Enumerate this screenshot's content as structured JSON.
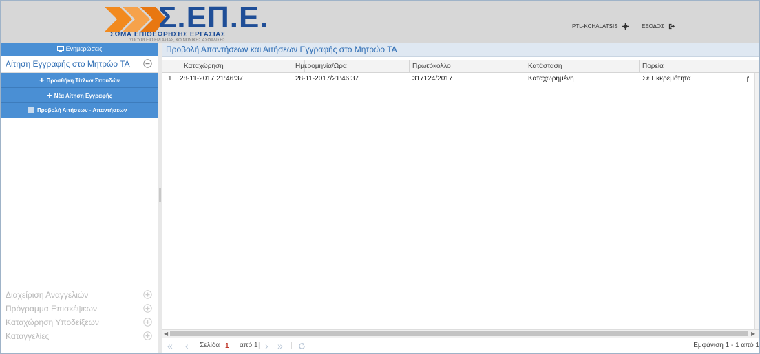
{
  "brand": {
    "logo_mark": "Σ.ΕΠ.Ε.",
    "logo_subtitle": "ΣΩΜΑ ΕΠΙΘΕΩΡΗΣΗΣ ΕΡΓΑΣΙΑΣ",
    "logo_small": "ΥΠΟΥΡΓΕΙΟ ΕΡΓΑΣΙΑΣ, ΚΟΙΝΩΝΙΚΗΣ ΑΣΦΑΛΙΣΗΣ",
    "accent_color": "#1f4e97",
    "chevron_color": "#f28a1e"
  },
  "header": {
    "user": "PTL-KCHALATSIS",
    "user_icon": "gear-icon",
    "logout": "ΕΞΟΔΟΣ",
    "logout_icon": "sign-out-icon"
  },
  "sidebar": {
    "top_item": "Ενημερώσεις",
    "active_section": "Αίτηση Εγγραφής στο Μητρώο ΤΑ",
    "sub_items": [
      {
        "label": "Προσθήκη Τίτλων Σπουδών",
        "icon": "plus-icon"
      },
      {
        "label": "Νέα Αίτηση Εγγραφής",
        "icon": "plus-icon"
      },
      {
        "label": "Προβολή Αιτήσεων - Απαντήσεων",
        "icon": "list-icon"
      }
    ],
    "collapsed_sections": [
      "Διαχείριση Αναγγελιών",
      "Πρόγραμμα Επισκέψεων",
      "Καταχώρηση Υποδείξεων",
      "Καταγγελίες"
    ],
    "color": "#4a8fd4"
  },
  "main": {
    "title": "Προβολή Απαντήσεων και Αιτήσεων Εγγραφής στο Μητρώο ΤΑ",
    "columns": [
      "Καταχώρηση",
      "Ημερομηνία/Ωρα",
      "Πρωτόκολλο",
      "Κατάσταση",
      "Πορεία"
    ],
    "rows": [
      {
        "num": "1",
        "cells": [
          "28-11-2017 21:46:37",
          "28-11-2017/21:46:37",
          "317124/2017",
          "Καταχωρημένη",
          "Σε Εκκρεμότητα"
        ]
      }
    ],
    "pager": {
      "page_label": "Σελίδα",
      "page_value": "1",
      "of_label": "από 1",
      "info": "Εμφάνιση 1 - 1 από 1"
    }
  }
}
